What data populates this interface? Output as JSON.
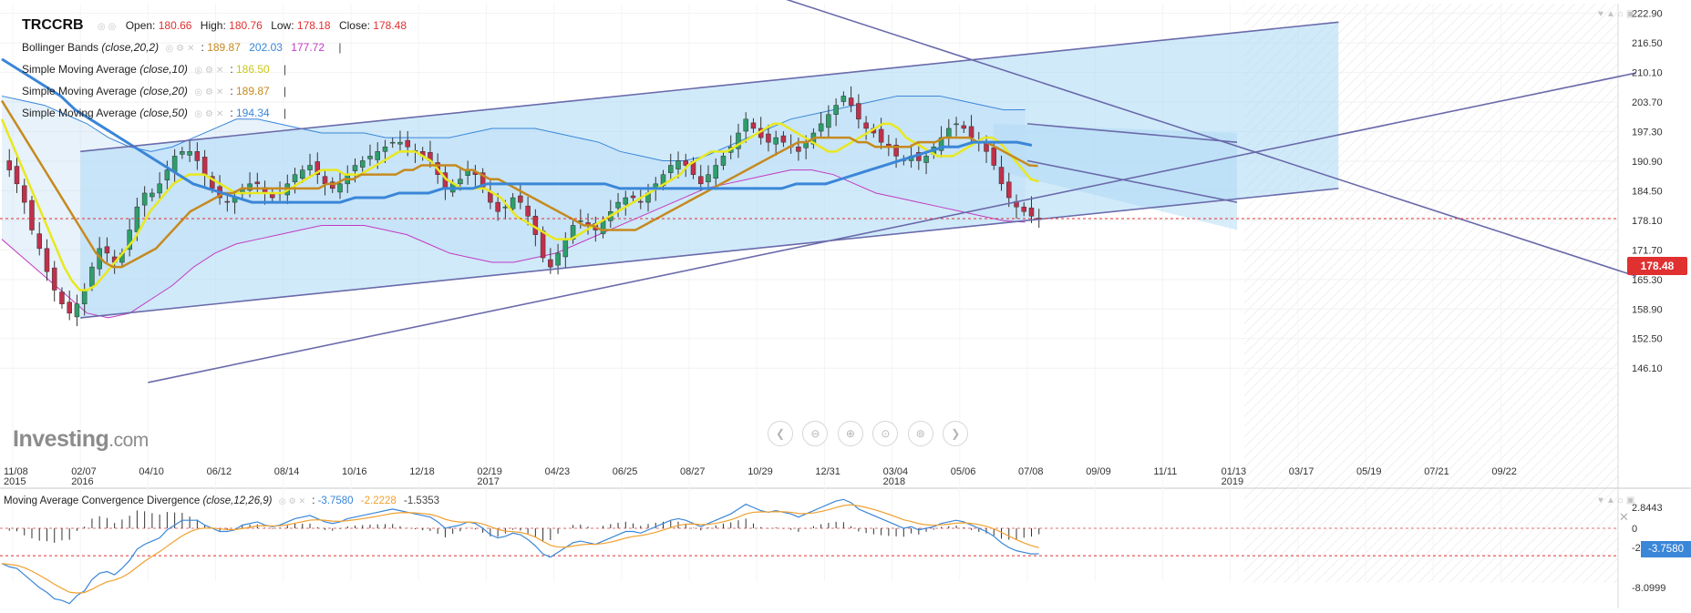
{
  "header": {
    "symbol": "TRCCRB",
    "ohlc": [
      {
        "label": "Open:",
        "value": "180.66"
      },
      {
        "label": "High:",
        "value": "180.76"
      },
      {
        "label": "Low:",
        "value": "178.18"
      },
      {
        "label": "Close:",
        "value": "178.48"
      }
    ]
  },
  "indicators": [
    {
      "name": "Bollinger Bands",
      "params": "(close,20,2)",
      "values": [
        "189.87",
        "202.03",
        "177.72"
      ],
      "colors": [
        "#c58a1e",
        "#3a86d8",
        "#c23ac2"
      ]
    },
    {
      "name": "Simple Moving Average",
      "params": "(close,10)",
      "values": [
        "186.50"
      ],
      "colors": [
        "#d4d41a"
      ]
    },
    {
      "name": "Simple Moving Average",
      "params": "(close,20)",
      "values": [
        "189.87"
      ],
      "colors": [
        "#c58a1e"
      ]
    },
    {
      "name": "Simple Moving Average",
      "params": "(close,50)",
      "values": [
        "194.34"
      ],
      "colors": [
        "#3a86d8"
      ]
    }
  ],
  "macd_legend": {
    "name": "Moving Average Convergence Divergence",
    "params": "(close,12,26,9)",
    "values": [
      "-3.7580",
      "-2.2228",
      "-1.5353"
    ]
  },
  "logo": {
    "text": "Investing",
    "suffix": ".com"
  },
  "nav_icons": [
    "chevron-left-icon",
    "zoom-out-icon",
    "zoom-in-icon",
    "zoom-reset-icon",
    "chevron-right-icon"
  ],
  "current_price_label": "178.48",
  "macd_current_label": "-3.7580",
  "colors": {
    "up": "#2e9e6a",
    "down": "#c0304a",
    "sma10": "#e8e81e",
    "sma20": "#c58a1e",
    "sma50": "#3a86d8",
    "bb_upper": "#3a86d8",
    "bb_lower": "#c23ac2",
    "channel_fill": "#a9d8f5",
    "trendline": "#6a6aaa",
    "price_line": "#e03030",
    "macd_line": "#3a86d8",
    "signal_line": "#f0a030"
  },
  "chart_data": {
    "type": "candlestick",
    "x_ticks": [
      "11/08",
      "02/07",
      "04/10",
      "06/12",
      "08/14",
      "10/16",
      "12/18",
      "02/19",
      "04/23",
      "06/25",
      "08/27",
      "10/29",
      "12/31",
      "03/04",
      "05/06",
      "07/08",
      "09/09",
      "11/11",
      "01/13",
      "03/17",
      "05/19",
      "07/21",
      "09/22"
    ],
    "x_year_labels": [
      {
        "tick": 0,
        "year": "2015"
      },
      {
        "tick": 1,
        "year": "2016"
      },
      {
        "tick": 7,
        "year": "2017"
      },
      {
        "tick": 13,
        "year": "2018"
      },
      {
        "tick": 18,
        "year": "2019"
      }
    ],
    "y_ticks": [
      "222.90",
      "216.50",
      "210.10",
      "203.70",
      "197.30",
      "190.90",
      "184.50",
      "178.10",
      "171.70",
      "165.30",
      "158.90",
      "152.50",
      "146.10"
    ],
    "y_range": [
      142.0,
      225.0
    ],
    "macd_y_ticks": [
      "2.8443",
      "0",
      "-2.6278",
      "-8.0999"
    ],
    "macd_y_range": [
      -11.0,
      4.0
    ],
    "weeks_per_tick": 9,
    "price_path": [
      191,
      189,
      186,
      182,
      176,
      172,
      167,
      163,
      160,
      158,
      160,
      163,
      168,
      172,
      171,
      169,
      171,
      176,
      181,
      184,
      184,
      186,
      189,
      192,
      193,
      193,
      191,
      188,
      185,
      183,
      182,
      183,
      185,
      186,
      186,
      184,
      183,
      184,
      186,
      188,
      189,
      190,
      188,
      186,
      185,
      186,
      188,
      190,
      191,
      192,
      193,
      194,
      195,
      195,
      194,
      193,
      192,
      191,
      188,
      185,
      186,
      187,
      189,
      188,
      185,
      182,
      180,
      181,
      183,
      182,
      179,
      175,
      170,
      168,
      171,
      174,
      177,
      178,
      177,
      176,
      178,
      180,
      182,
      183,
      183,
      182,
      184,
      186,
      188,
      190,
      191,
      190,
      188,
      186,
      188,
      190,
      192,
      194,
      197,
      200,
      198,
      196,
      195,
      196,
      195,
      194,
      193,
      195,
      197,
      199,
      201,
      203,
      205,
      203,
      200,
      198,
      197,
      195,
      194,
      192,
      191,
      192,
      191,
      192,
      194,
      196,
      198,
      199,
      198,
      196,
      195,
      193,
      190,
      186,
      183,
      181,
      180,
      179,
      178.48
    ],
    "sma10": [
      200,
      196,
      192,
      188,
      184,
      180,
      176,
      172,
      168,
      165,
      163,
      163,
      164,
      166,
      168,
      170,
      172,
      174,
      177,
      180,
      182,
      184,
      186,
      187,
      188,
      188,
      188,
      187,
      186,
      185,
      184,
      184,
      184,
      184,
      184,
      184,
      184,
      185,
      186,
      187,
      188,
      189,
      189,
      189,
      188,
      188,
      188,
      189,
      190,
      191,
      192,
      193,
      193,
      193,
      192,
      191,
      189,
      187,
      186,
      185,
      185,
      185,
      185,
      184,
      183,
      181,
      179,
      178,
      177,
      176,
      175,
      174,
      174,
      174,
      175,
      176,
      177,
      178,
      179,
      180,
      181,
      182,
      183,
      184,
      185,
      186,
      187,
      188,
      190,
      191,
      192,
      193,
      193,
      193,
      194,
      195,
      196,
      197,
      198,
      199,
      199,
      198,
      197,
      196,
      195,
      194,
      193,
      193,
      194,
      195,
      196,
      197,
      198,
      199,
      199,
      198,
      196,
      195,
      194,
      193,
      192,
      192,
      192,
      193,
      194,
      195,
      196,
      196,
      195,
      193,
      191,
      189,
      187,
      186.5
    ],
    "sma20": [
      204,
      201,
      198,
      195,
      192,
      189,
      186,
      183,
      180,
      177,
      174,
      171,
      169,
      168,
      168,
      169,
      170,
      171,
      172,
      174,
      176,
      178,
      180,
      181,
      182,
      183,
      184,
      184,
      185,
      185,
      185,
      185,
      185,
      185,
      185,
      185,
      185,
      185,
      186,
      186,
      187,
      187,
      188,
      188,
      188,
      188,
      188,
      189,
      189,
      190,
      190,
      190,
      190,
      190,
      189,
      189,
      188,
      187,
      187,
      186,
      185,
      184,
      183,
      182,
      181,
      180,
      179,
      178,
      177,
      177,
      176,
      176,
      176,
      176,
      176,
      177,
      178,
      179,
      180,
      181,
      182,
      183,
      184,
      185,
      186,
      187,
      188,
      189,
      190,
      191,
      192,
      193,
      194,
      195,
      195,
      196,
      196,
      196,
      196,
      196,
      195,
      195,
      194,
      194,
      194,
      194,
      194,
      195,
      195,
      195,
      196,
      196,
      196,
      196,
      195,
      195,
      194,
      193,
      192,
      191,
      190,
      189.87
    ],
    "sma50": [
      213,
      211,
      209,
      207,
      205,
      202,
      200,
      198,
      196,
      194,
      192,
      190,
      188,
      186,
      185,
      184,
      183,
      182,
      182,
      182,
      182,
      182,
      182,
      182,
      183,
      183,
      183,
      184,
      184,
      184,
      185,
      185,
      185,
      186,
      186,
      186,
      186,
      186,
      186,
      186,
      186,
      186,
      185,
      185,
      185,
      185,
      185,
      185,
      185,
      185,
      185,
      185,
      185,
      185,
      186,
      186,
      186,
      187,
      188,
      189,
      190,
      191,
      192,
      193,
      194,
      194,
      195,
      195,
      195,
      195,
      194.34
    ],
    "bb_upper": [
      205,
      204,
      203,
      201,
      199,
      196,
      194,
      193,
      194,
      196,
      198,
      200,
      200,
      199,
      198,
      197,
      197,
      197,
      196,
      196,
      196,
      196,
      197,
      198,
      198,
      198,
      197,
      196,
      195,
      193,
      192,
      191,
      191,
      192,
      194,
      196,
      198,
      200,
      201,
      202,
      203,
      204,
      205,
      205,
      205,
      204,
      203,
      202,
      202.03
    ],
    "bb_lower": [
      174,
      170,
      166,
      162,
      158,
      157,
      158,
      161,
      164,
      168,
      171,
      173,
      174,
      175,
      176,
      177,
      177,
      177,
      176,
      175,
      173,
      171,
      170,
      169,
      169,
      170,
      171,
      173,
      175,
      177,
      179,
      181,
      183,
      185,
      186,
      187,
      188,
      189,
      189,
      188,
      186,
      184,
      183,
      182,
      181,
      180,
      179,
      178,
      177.72
    ],
    "trendlines": [
      {
        "from": [
          1,
          193
        ],
        "to": [
          19.6,
          221
        ]
      },
      {
        "from": [
          1,
          157
        ],
        "to": [
          19.6,
          185
        ]
      },
      {
        "from": [
          2,
          143
        ],
        "to": [
          24,
          210
        ]
      },
      {
        "from": [
          11,
          228
        ],
        "to": [
          24,
          166
        ]
      },
      {
        "from": [
          15,
          199
        ],
        "to": [
          18.1,
          195
        ]
      },
      {
        "from": [
          15,
          191
        ],
        "to": [
          18.1,
          182
        ]
      }
    ],
    "channels": [
      {
        "top": [
          [
            1,
            193
          ],
          [
            19.6,
            221
          ]
        ],
        "bottom": [
          [
            1,
            157
          ],
          [
            19.6,
            185
          ]
        ]
      },
      {
        "top": [
          [
            14.5,
            199
          ],
          [
            18.1,
            197
          ]
        ],
        "bottom": [
          [
            14.5,
            189
          ],
          [
            18.1,
            176
          ]
        ]
      }
    ],
    "current_price": 178.48
  }
}
